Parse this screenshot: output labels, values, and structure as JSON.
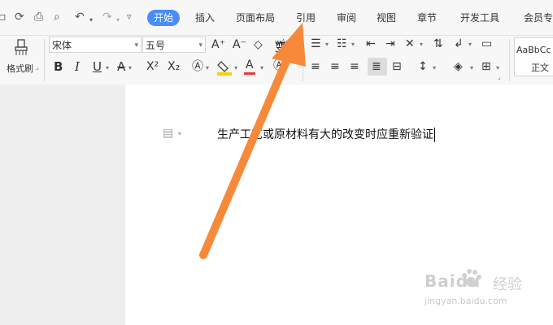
{
  "tabs": {
    "home": "开始",
    "insert": "插入",
    "page_layout": "页面布局",
    "references": "引用",
    "review": "审阅",
    "view": "视图",
    "section": "章节",
    "developer": "开发工具",
    "member": "会员专"
  },
  "ribbon": {
    "format_painter_label": "格式刷",
    "font_name": "宋体",
    "font_size": "五号",
    "style_preview": "AaBbCc",
    "style_name": "正文",
    "bold": "B",
    "italic": "I",
    "underline": "U",
    "superscript": "X²",
    "subscript": "X₂",
    "pinyin": "wén",
    "grow_font": "A⁺",
    "shrink_font": "A⁻"
  },
  "document": {
    "text": "生产工艺或原材料有大的改变时应重新验证"
  },
  "watermark": {
    "brand": "Baidu",
    "product": "经验",
    "url": "jingyan.baidu.com"
  },
  "colors": {
    "accent": "#4a8df8",
    "arrow": "#f68a3a",
    "highlight": "#f5d400",
    "font_color": "#e23b3b"
  }
}
